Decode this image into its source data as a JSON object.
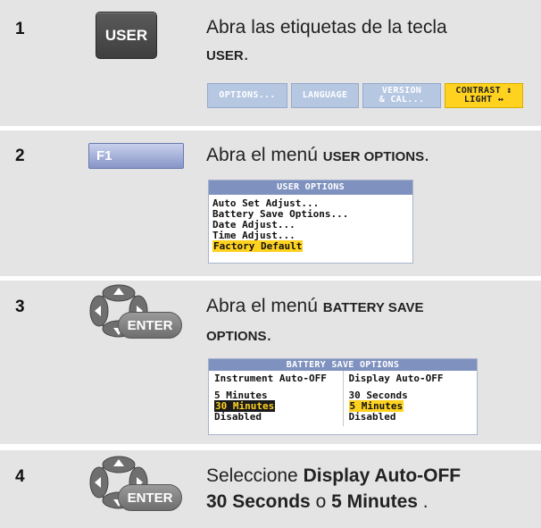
{
  "steps": [
    {
      "number": "1",
      "key_label": "USER",
      "desc_text": "Abra las etiquetas de la tecla",
      "desc_bold": "USER",
      "desc_end": ".",
      "softkeys": [
        {
          "line1": "OPTIONS...",
          "line2": ""
        },
        {
          "line1": "LANGUAGE",
          "line2": ""
        },
        {
          "line1": "VERSION",
          "line2": "& CAL..."
        },
        {
          "line1": "CONTRAST ↕",
          "line2": "LIGHT ↔"
        }
      ]
    },
    {
      "number": "2",
      "key_label": "F1",
      "desc_text": "Abra el menú ",
      "desc_bold": "USER OPTIONS",
      "desc_end": ".",
      "panel_title": "USER OPTIONS",
      "menu_items": [
        "Auto Set Adjust...",
        "Battery Save Options...",
        "Date Adjust...",
        "Time Adjust...",
        "Factory Default"
      ]
    },
    {
      "number": "3",
      "key_label": "ENTER",
      "desc_text": "Abra el menú ",
      "desc_bold1": "BATTERY SAVE",
      "desc_bold2": "OPTIONS",
      "desc_end": ".",
      "panel_title": "BATTERY SAVE OPTIONS",
      "left_col": {
        "header": "Instrument Auto-OFF",
        "items": [
          "5 Minutes",
          "30 Minutes",
          "Disabled"
        ]
      },
      "right_col": {
        "header": "Display Auto-OFF",
        "items": [
          "30 Seconds",
          "5 Minutes",
          "Disabled"
        ]
      }
    },
    {
      "number": "4",
      "key_label": "ENTER",
      "desc_pre": "Seleccione ",
      "desc_bold1": "Display Auto-OFF",
      "desc_bold2": "30 Seconds",
      "desc_mid": " o ",
      "desc_bold3": "5 Minutes",
      "desc_end": " ."
    }
  ],
  "colors": {
    "row_bg": "#e4e4e4",
    "highlight": "#ffd21f",
    "softkey": "#b6c7e2",
    "panel_title": "#7f91bf"
  }
}
